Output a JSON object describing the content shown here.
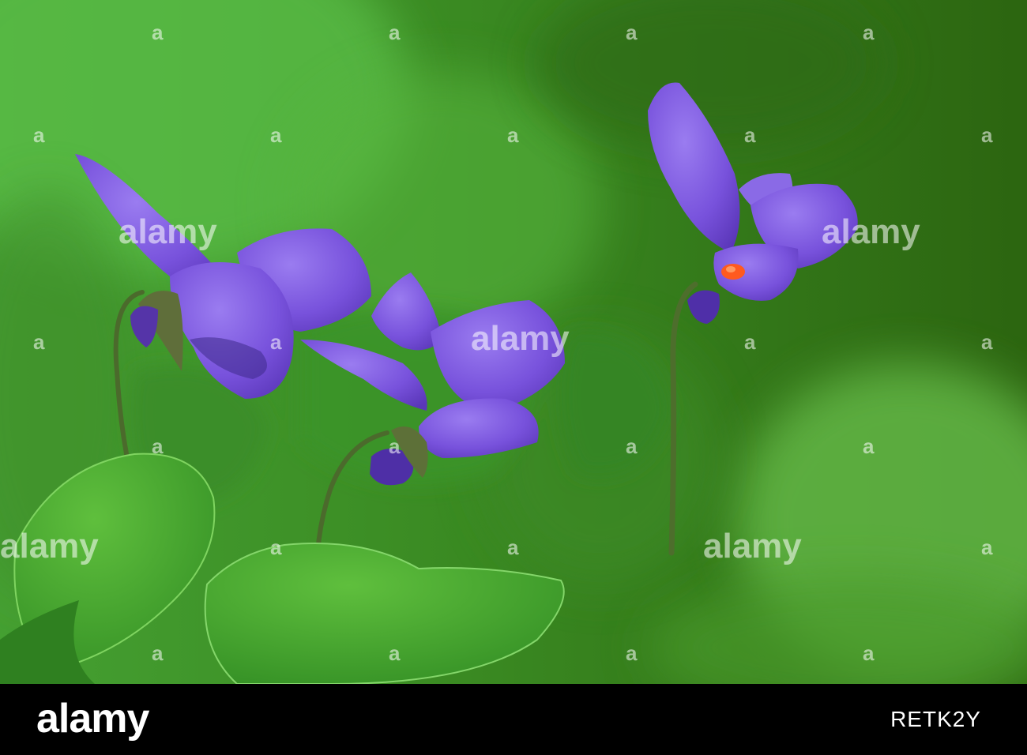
{
  "watermark": {
    "text": "alamy",
    "glyph": "a"
  },
  "banner": {
    "logo": "alamy",
    "image_id": "RETK2Y"
  },
  "colors": {
    "petal": "#7b55de",
    "petal_dark": "#5a34b8",
    "leaf": "#3f9a2a",
    "background_green": "#2f6a12",
    "anther": "#ff5a1f",
    "banner": "#000000"
  }
}
